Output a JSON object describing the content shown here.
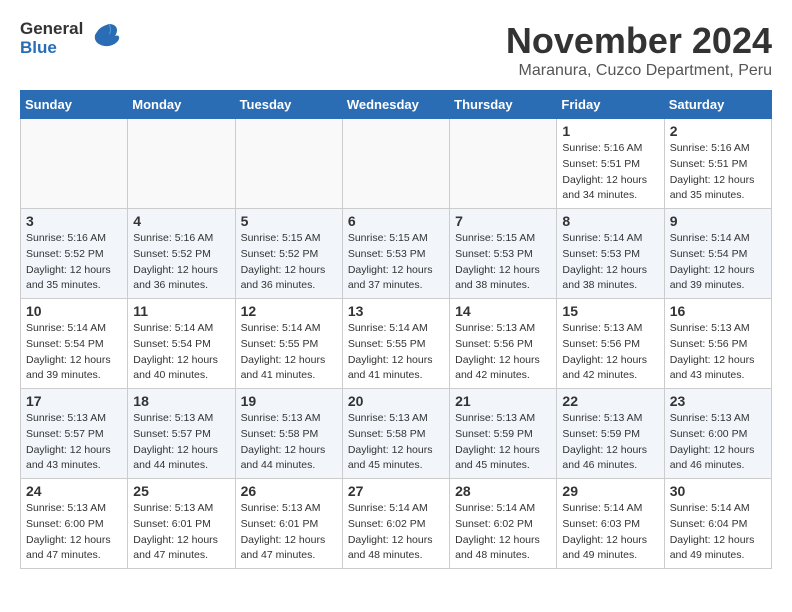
{
  "header": {
    "logo_general": "General",
    "logo_blue": "Blue",
    "month_year": "November 2024",
    "location": "Maranura, Cuzco Department, Peru"
  },
  "weekdays": [
    "Sunday",
    "Monday",
    "Tuesday",
    "Wednesday",
    "Thursday",
    "Friday",
    "Saturday"
  ],
  "weeks": [
    [
      {
        "day": "",
        "info": ""
      },
      {
        "day": "",
        "info": ""
      },
      {
        "day": "",
        "info": ""
      },
      {
        "day": "",
        "info": ""
      },
      {
        "day": "",
        "info": ""
      },
      {
        "day": "1",
        "info": "Sunrise: 5:16 AM\nSunset: 5:51 PM\nDaylight: 12 hours\nand 34 minutes."
      },
      {
        "day": "2",
        "info": "Sunrise: 5:16 AM\nSunset: 5:51 PM\nDaylight: 12 hours\nand 35 minutes."
      }
    ],
    [
      {
        "day": "3",
        "info": "Sunrise: 5:16 AM\nSunset: 5:52 PM\nDaylight: 12 hours\nand 35 minutes."
      },
      {
        "day": "4",
        "info": "Sunrise: 5:16 AM\nSunset: 5:52 PM\nDaylight: 12 hours\nand 36 minutes."
      },
      {
        "day": "5",
        "info": "Sunrise: 5:15 AM\nSunset: 5:52 PM\nDaylight: 12 hours\nand 36 minutes."
      },
      {
        "day": "6",
        "info": "Sunrise: 5:15 AM\nSunset: 5:53 PM\nDaylight: 12 hours\nand 37 minutes."
      },
      {
        "day": "7",
        "info": "Sunrise: 5:15 AM\nSunset: 5:53 PM\nDaylight: 12 hours\nand 38 minutes."
      },
      {
        "day": "8",
        "info": "Sunrise: 5:14 AM\nSunset: 5:53 PM\nDaylight: 12 hours\nand 38 minutes."
      },
      {
        "day": "9",
        "info": "Sunrise: 5:14 AM\nSunset: 5:54 PM\nDaylight: 12 hours\nand 39 minutes."
      }
    ],
    [
      {
        "day": "10",
        "info": "Sunrise: 5:14 AM\nSunset: 5:54 PM\nDaylight: 12 hours\nand 39 minutes."
      },
      {
        "day": "11",
        "info": "Sunrise: 5:14 AM\nSunset: 5:54 PM\nDaylight: 12 hours\nand 40 minutes."
      },
      {
        "day": "12",
        "info": "Sunrise: 5:14 AM\nSunset: 5:55 PM\nDaylight: 12 hours\nand 41 minutes."
      },
      {
        "day": "13",
        "info": "Sunrise: 5:14 AM\nSunset: 5:55 PM\nDaylight: 12 hours\nand 41 minutes."
      },
      {
        "day": "14",
        "info": "Sunrise: 5:13 AM\nSunset: 5:56 PM\nDaylight: 12 hours\nand 42 minutes."
      },
      {
        "day": "15",
        "info": "Sunrise: 5:13 AM\nSunset: 5:56 PM\nDaylight: 12 hours\nand 42 minutes."
      },
      {
        "day": "16",
        "info": "Sunrise: 5:13 AM\nSunset: 5:56 PM\nDaylight: 12 hours\nand 43 minutes."
      }
    ],
    [
      {
        "day": "17",
        "info": "Sunrise: 5:13 AM\nSunset: 5:57 PM\nDaylight: 12 hours\nand 43 minutes."
      },
      {
        "day": "18",
        "info": "Sunrise: 5:13 AM\nSunset: 5:57 PM\nDaylight: 12 hours\nand 44 minutes."
      },
      {
        "day": "19",
        "info": "Sunrise: 5:13 AM\nSunset: 5:58 PM\nDaylight: 12 hours\nand 44 minutes."
      },
      {
        "day": "20",
        "info": "Sunrise: 5:13 AM\nSunset: 5:58 PM\nDaylight: 12 hours\nand 45 minutes."
      },
      {
        "day": "21",
        "info": "Sunrise: 5:13 AM\nSunset: 5:59 PM\nDaylight: 12 hours\nand 45 minutes."
      },
      {
        "day": "22",
        "info": "Sunrise: 5:13 AM\nSunset: 5:59 PM\nDaylight: 12 hours\nand 46 minutes."
      },
      {
        "day": "23",
        "info": "Sunrise: 5:13 AM\nSunset: 6:00 PM\nDaylight: 12 hours\nand 46 minutes."
      }
    ],
    [
      {
        "day": "24",
        "info": "Sunrise: 5:13 AM\nSunset: 6:00 PM\nDaylight: 12 hours\nand 47 minutes."
      },
      {
        "day": "25",
        "info": "Sunrise: 5:13 AM\nSunset: 6:01 PM\nDaylight: 12 hours\nand 47 minutes."
      },
      {
        "day": "26",
        "info": "Sunrise: 5:13 AM\nSunset: 6:01 PM\nDaylight: 12 hours\nand 47 minutes."
      },
      {
        "day": "27",
        "info": "Sunrise: 5:14 AM\nSunset: 6:02 PM\nDaylight: 12 hours\nand 48 minutes."
      },
      {
        "day": "28",
        "info": "Sunrise: 5:14 AM\nSunset: 6:02 PM\nDaylight: 12 hours\nand 48 minutes."
      },
      {
        "day": "29",
        "info": "Sunrise: 5:14 AM\nSunset: 6:03 PM\nDaylight: 12 hours\nand 49 minutes."
      },
      {
        "day": "30",
        "info": "Sunrise: 5:14 AM\nSunset: 6:04 PM\nDaylight: 12 hours\nand 49 minutes."
      }
    ]
  ]
}
